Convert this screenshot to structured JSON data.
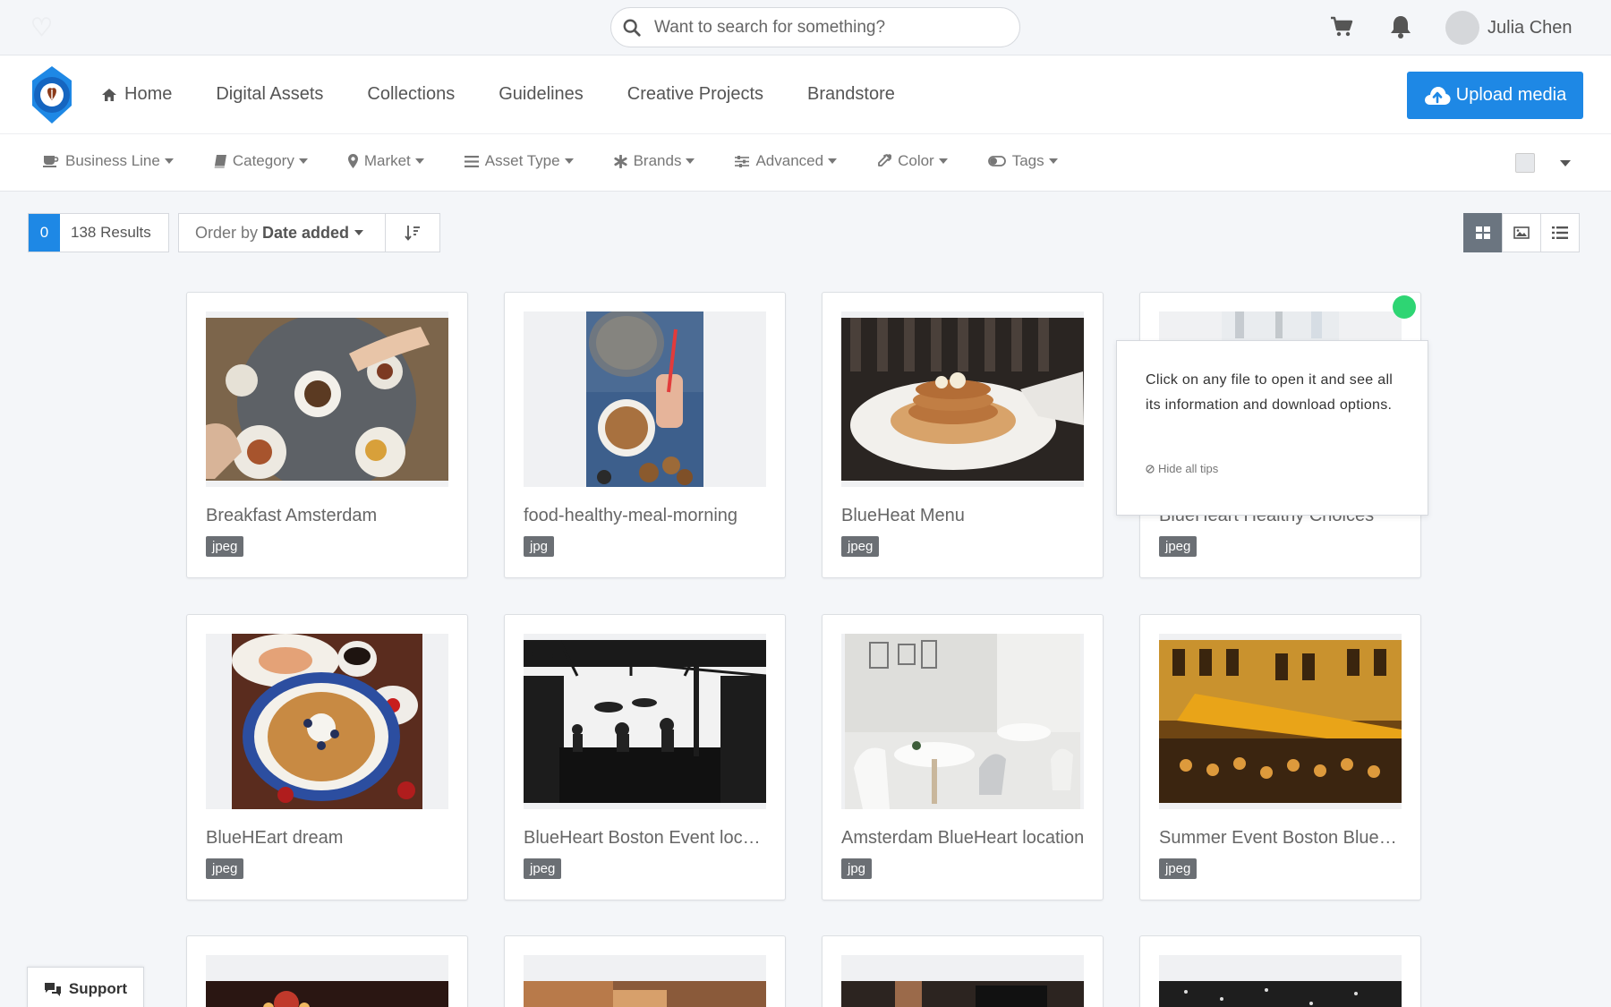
{
  "header": {
    "search_placeholder": "Want to search for something?",
    "user_name": "Julia Chen"
  },
  "nav": {
    "items": [
      "Home",
      "Digital Assets",
      "Collections",
      "Guidelines",
      "Creative Projects",
      "Brandstore"
    ],
    "upload_label": "Upload media"
  },
  "filters": {
    "items": [
      "Business Line",
      "Category",
      "Market",
      "Asset Type",
      "Brands",
      "Advanced",
      "Color",
      "Tags"
    ]
  },
  "toolbar": {
    "selected_count": "0",
    "results_label": "138 Results",
    "order_prefix": "Order by",
    "order_value": "Date added"
  },
  "assets": [
    {
      "title": "Breakfast Amsterdam",
      "ext": "jpeg"
    },
    {
      "title": "food-healthy-meal-morning",
      "ext": "jpg"
    },
    {
      "title": "BlueHeat Menu",
      "ext": "jpeg"
    },
    {
      "title": "BlueHeart Healthy Choices",
      "ext": "jpeg"
    },
    {
      "title": "BlueHEart dream",
      "ext": "jpeg"
    },
    {
      "title": "BlueHeart Boston Event location",
      "ext": "jpeg"
    },
    {
      "title": "Amsterdam BlueHeart location",
      "ext": "jpg"
    },
    {
      "title": "Summer Event Boston BlueHeart",
      "ext": "jpeg"
    }
  ],
  "tip": {
    "text": "Click on any file to open it and see all its information and download options.",
    "hide_label": "Hide all tips"
  },
  "support_label": "Support",
  "colors": {
    "accent": "#1e88e5",
    "tip_dot": "#2ed573",
    "badge_grey": "#6b6f74"
  }
}
